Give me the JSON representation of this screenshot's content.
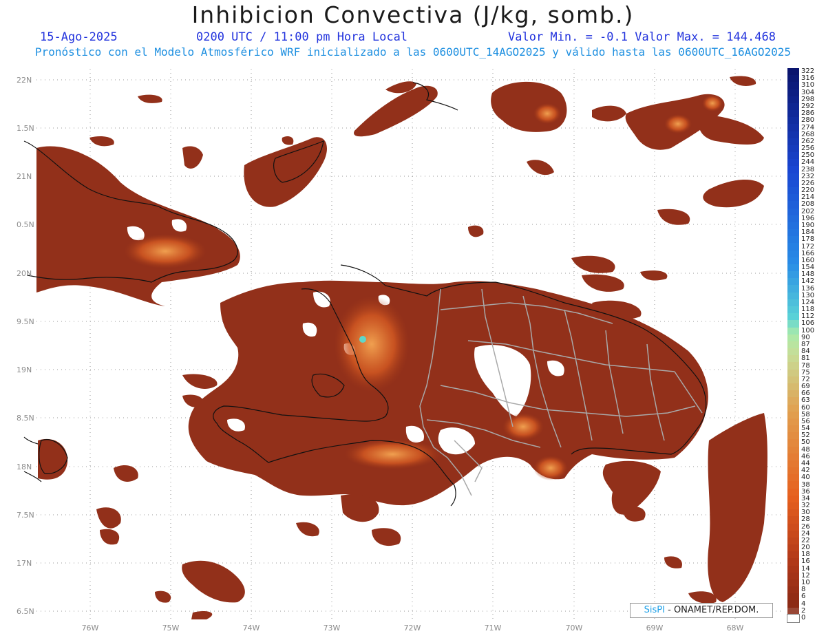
{
  "header": {
    "title": "Inhibicion Convectiva (J/kg, somb.)",
    "date": "15-Ago-2025",
    "time": "0200 UTC / 11:00 pm Hora Local",
    "minmax": "Valor Min. = -0.1  Valor Max. = 144.468",
    "model_info": "Pronóstico con el Modelo Atmosférico WRF inicializado a las 0600UTC_14AGO2025 y válido hasta las  0600UTC_16AGO2025"
  },
  "axes": {
    "lat_labels": [
      "22N",
      "1.5N",
      "21N",
      "0.5N",
      "20N",
      "9.5N",
      "19N",
      "8.5N",
      "18N",
      "7.5N",
      "17N",
      "6.5N"
    ],
    "lon_labels": [
      "76W",
      "75W",
      "74W",
      "73W",
      "72W",
      "71W",
      "70W",
      "69W",
      "68W"
    ]
  },
  "colorbar": {
    "labels": [
      "322",
      "316",
      "310",
      "304",
      "298",
      "292",
      "286",
      "280",
      "274",
      "268",
      "262",
      "256",
      "250",
      "244",
      "238",
      "232",
      "226",
      "220",
      "214",
      "208",
      "202",
      "196",
      "190",
      "184",
      "178",
      "172",
      "166",
      "160",
      "154",
      "148",
      "142",
      "136",
      "130",
      "124",
      "118",
      "112",
      "106",
      "100",
      "90",
      "87",
      "84",
      "81",
      "78",
      "75",
      "72",
      "69",
      "66",
      "63",
      "60",
      "58",
      "56",
      "54",
      "52",
      "50",
      "48",
      "46",
      "44",
      "42",
      "40",
      "38",
      "36",
      "34",
      "32",
      "30",
      "28",
      "26",
      "24",
      "22",
      "20",
      "18",
      "16",
      "14",
      "12",
      "10",
      "8",
      "6",
      "4",
      "2",
      "0"
    ]
  },
  "credit": {
    "logo": "SisPI",
    "text": " - ONAMET/REP.DOM."
  },
  "colors": {
    "fill_low": "#8e2e14",
    "fill_mid": "#b8461c",
    "fill_hot": "#e8762c",
    "coast": "#111111",
    "province": "#a9a9a9"
  }
}
